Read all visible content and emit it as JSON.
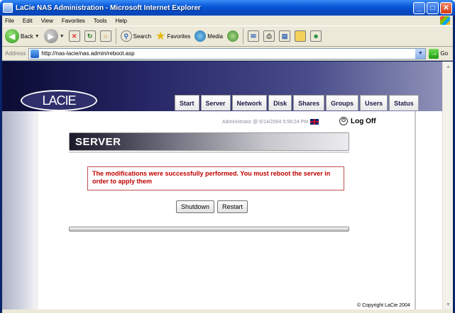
{
  "window": {
    "title": "LaCie NAS Administration - Microsoft Internet Explorer",
    "controls": {
      "minimize": "_",
      "maximize": "□",
      "close": "✕"
    }
  },
  "menu": {
    "items": [
      "File",
      "Edit",
      "View",
      "Favorites",
      "Tools",
      "Help"
    ]
  },
  "toolbar": {
    "back": "Back",
    "search": "Search",
    "favorites": "Favorites",
    "media": "Media"
  },
  "address": {
    "label": "Address",
    "url": "http://nas-lacie/nas.admin/reboot.asp",
    "go": "Go"
  },
  "page": {
    "logo": "LACIE",
    "tabs": [
      "Start",
      "Server",
      "Network",
      "Disk",
      "Shares",
      "Groups",
      "Users",
      "Status"
    ],
    "admin_info": "Administrator @ 6/14/2004 5:58:24 PM",
    "logoff": "Log Off",
    "section_title": "SERVER",
    "message": "The modifications were successfully performed. You must reboot the server in order to apply them",
    "buttons": {
      "shutdown": "Shutdown",
      "restart": "Restart"
    },
    "copyright": "© Copyright LaCie 2004"
  },
  "colors": {
    "accent": "#0a5ad8",
    "error_text": "#c00000",
    "header_dark": "#0b0b34"
  }
}
